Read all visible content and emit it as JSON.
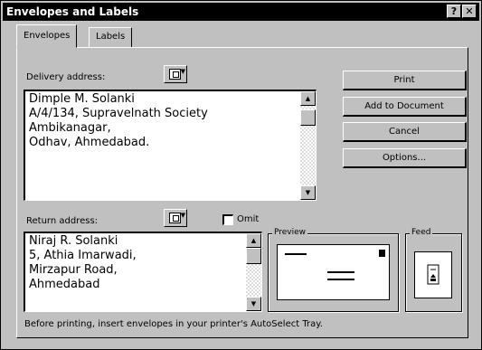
{
  "window": {
    "title": "Envelopes and Labels",
    "help_button": "?",
    "close_button": "✕"
  },
  "tabs": [
    {
      "label": "Envelopes",
      "active": true
    },
    {
      "label": "Labels",
      "active": false
    }
  ],
  "delivery": {
    "label": "Delivery address:",
    "lines": [
      "Dimple M. Solanki",
      "A/4/134, Supravelnath Society",
      "Ambikanagar,",
      "Odhav, Ahmedabad."
    ]
  },
  "return": {
    "label": "Return address:",
    "omit_label": "Omit",
    "omit_checked": false,
    "lines": [
      "Niraj R. Solanki",
      "5, Athia Imarwadi,",
      "Mirzapur Road,",
      "Ahmedabad"
    ]
  },
  "buttons": {
    "print": "Print",
    "add_to_document": "Add to Document",
    "cancel": "Cancel",
    "options": "Options..."
  },
  "preview": {
    "label": "Preview"
  },
  "feed": {
    "label": "Feed"
  },
  "status": "Before printing, insert envelopes in your printer's AutoSelect Tray.",
  "colors": {
    "dialog_face": "#c0c0c0",
    "title_bar": "#000000",
    "title_text": "#ffffff",
    "field_background": "#ffffff"
  },
  "icons": {
    "address_book": "address-book-icon",
    "dropdown": "triangle-down-icon",
    "scroll_up": "triangle-up-icon",
    "scroll_down": "triangle-down-icon"
  }
}
